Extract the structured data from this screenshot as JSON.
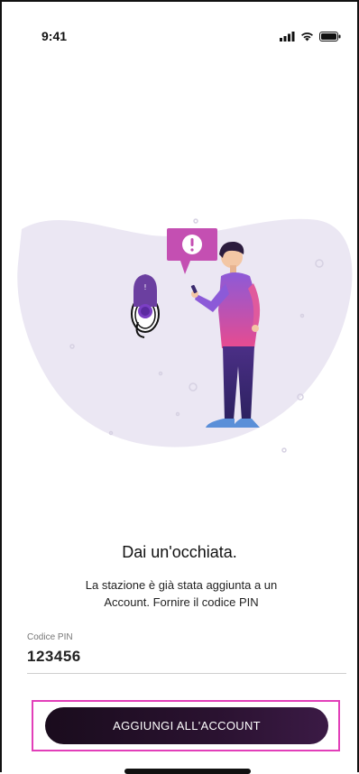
{
  "status_bar": {
    "time": "9:41",
    "icons": [
      "cellular-signal-icon",
      "wifi-icon",
      "battery-icon"
    ]
  },
  "illustration": {
    "description_icon": "person-with-phone-and-charger-illustration",
    "alert_bubble_icon": "exclamation-icon",
    "colors": {
      "blob": "#ebe7f3",
      "bubble": "#c44fb2",
      "shirt_top": "#8c5ad8",
      "shirt_bottom": "#e84b8f",
      "pants": "#3b2a6e",
      "shoes": "#5a8fd8",
      "charger": "#6b3fa0"
    }
  },
  "content": {
    "title": "Dai un'occhiata.",
    "subtitle_line1": "La stazione è già stata aggiunta a un",
    "subtitle_line2": "Account. Fornire il codice PIN"
  },
  "pin_field": {
    "label": "Codice PIN",
    "value": "123456"
  },
  "cta": {
    "label": "AGGIUNGI ALL'ACCOUNT",
    "highlight_color": "#e23fb9"
  }
}
